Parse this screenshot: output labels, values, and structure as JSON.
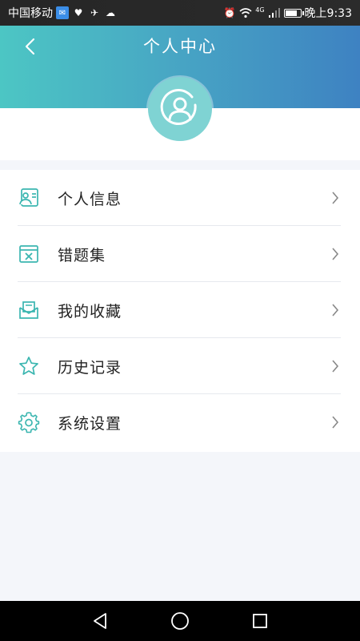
{
  "status_bar": {
    "carrier": "中国移动",
    "time": "晚上9:33",
    "network_label": "4G",
    "battery_level": 0.7
  },
  "header": {
    "title": "个人中心",
    "back_icon": "chevron-left-icon"
  },
  "avatar": {
    "icon": "user-icon"
  },
  "menu": {
    "items": [
      {
        "label": "个人信息",
        "icon": "id-card-icon"
      },
      {
        "label": "错题集",
        "icon": "mistake-book-icon"
      },
      {
        "label": "我的收藏",
        "icon": "favorites-mail-icon"
      },
      {
        "label": "历史记录",
        "icon": "star-icon"
      },
      {
        "label": "系统设置",
        "icon": "gear-icon"
      }
    ]
  },
  "nav_bar": {
    "back": "back-triangle-icon",
    "home": "home-circle-icon",
    "recents": "recents-square-icon"
  },
  "colors": {
    "accent": "#4cc6c4",
    "header_end": "#3e82c2",
    "icon_teal": "#3bb6b0",
    "text": "#222222"
  }
}
